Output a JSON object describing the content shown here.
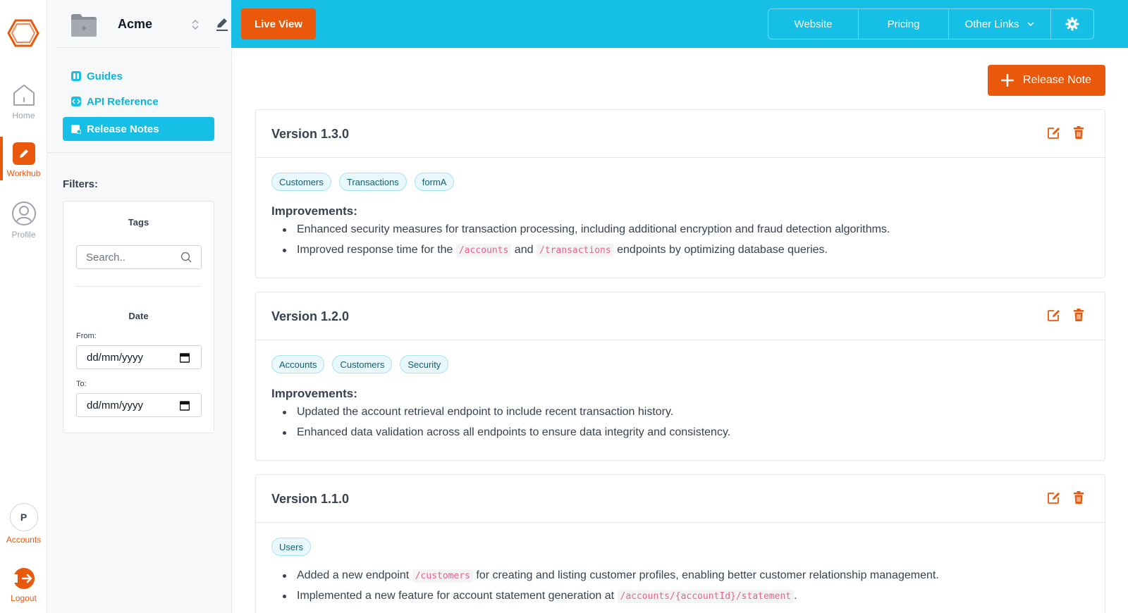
{
  "rail": {
    "home_label": "Home",
    "workhub_label": "Workhub",
    "profile_label": "Profile",
    "account_initial": "P",
    "accounts_label": "Accounts",
    "logout_label": "Logout"
  },
  "sidebar": {
    "project_name": "Acme",
    "nav": [
      "Guides",
      "API Reference",
      "Release Notes"
    ],
    "filters_title": "Filters:",
    "tags_title": "Tags",
    "search_placeholder": "Search..",
    "date_title": "Date",
    "from_label": "From:",
    "to_label": "To:",
    "from_value": "dd/mm/yyyy",
    "to_value": "dd/mm/yyyy"
  },
  "topbar": {
    "live_view": "Live View",
    "links": [
      "Website",
      "Pricing",
      "Other Links"
    ]
  },
  "main": {
    "add_button": "Release Note",
    "releases": [
      {
        "title": "Version 1.3.0",
        "tags": [
          "Customers",
          "Transactions",
          "formA"
        ],
        "section": "Improvements:",
        "items": [
          {
            "pre": "Enhanced security measures for transaction processing, including additional encryption and fraud detection algorithms."
          },
          {
            "pre": "Improved response time for the ",
            "code1": "/accounts",
            "mid": " and ",
            "code2": "/transactions",
            "post": " endpoints by optimizing database queries."
          }
        ]
      },
      {
        "title": "Version 1.2.0",
        "tags": [
          "Accounts",
          "Customers",
          "Security"
        ],
        "section": "Improvements:",
        "items": [
          {
            "pre": "Updated the account retrieval endpoint to include recent transaction history."
          },
          {
            "pre": "Enhanced data validation across all endpoints to ensure data integrity and consistency."
          }
        ]
      },
      {
        "title": "Version 1.1.0",
        "tags": [
          "Users"
        ],
        "items": [
          {
            "pre": "Added a new endpoint ",
            "code1": "/customers",
            "post": " for creating and listing customer profiles, enabling better customer relationship management."
          },
          {
            "pre": "Implemented a new feature for account statement generation at ",
            "code1": "/accounts/{accountId}/statement",
            "post": "."
          }
        ]
      }
    ]
  },
  "colors": {
    "accent_orange": "#ea580c",
    "accent_cyan": "#16bfe6"
  }
}
